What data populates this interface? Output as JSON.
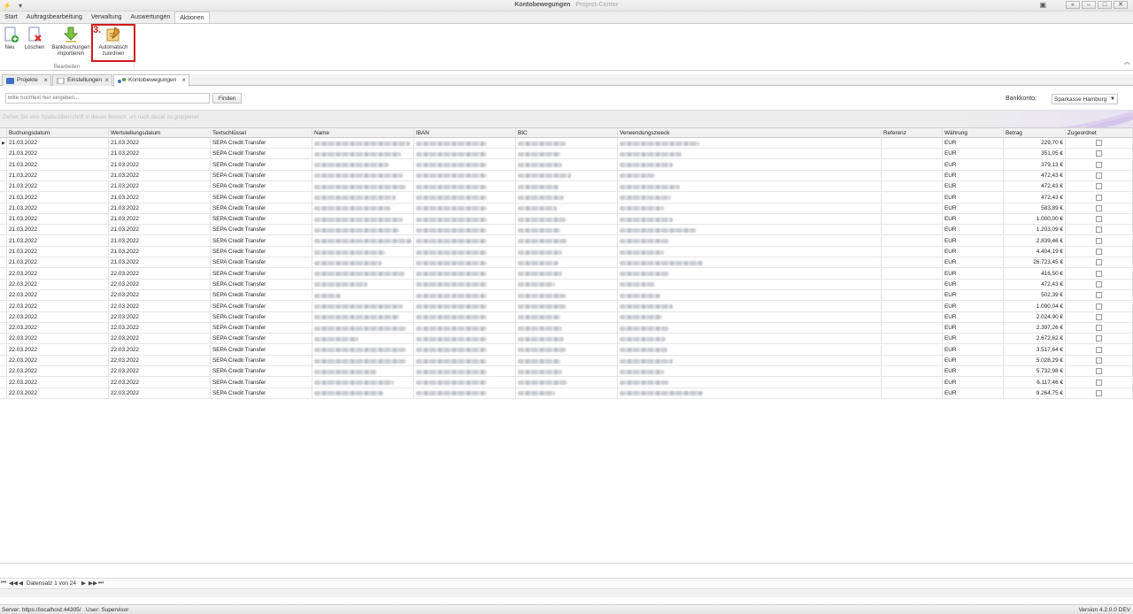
{
  "window": {
    "title": "Kontobewegungen",
    "subtitle": "Project-Center"
  },
  "ribbon_tabs": [
    "Start",
    "Auftragsbearbeitung",
    "Verwaltung",
    "Auswertungen",
    "Aktionen"
  ],
  "active_ribbon_tab": "Aktionen",
  "ribbon": {
    "group_label": "Bearbeiten",
    "buttons": {
      "neu": "Neu",
      "loeschen": "Löschen",
      "import_line1": "Bankbuchungen",
      "import_line2": "importieren",
      "auto_line1": "Automatisch",
      "auto_line2": "zuordnen"
    },
    "step_marker": "3.",
    "highlight_color": "#d11a1a"
  },
  "doc_tabs": [
    "Projekte",
    "Einstellungen",
    "Kontobewegungen"
  ],
  "active_doc_tab": "Kontobewegungen",
  "search": {
    "placeholder": "Bitte Suchtext hier eingeben...",
    "find_label": "Finden"
  },
  "bank": {
    "label": "Bankkonto:",
    "selected": "Sparkasse Hamburg"
  },
  "group_hint": "Ziehen Sie eine Spaltenüberschrift in diesen Bereich, um nach dieser zu gruppieren",
  "columns": [
    "Buchungsdatum",
    "Wertstellungsdatum",
    "Textschlüssel",
    "Name",
    "IBAN",
    "BIC",
    "Verwendungszweck",
    "Referenz",
    "Währung",
    "Betrag",
    "Zugeordnet"
  ],
  "rows": [
    {
      "buchung": "21.03.2022",
      "wert": "21.03.2022",
      "text": "SEPA Credit Transfer",
      "waehrung": "EUR",
      "betrag": "229,70 €"
    },
    {
      "buchung": "21.03.2022",
      "wert": "21.03.2022",
      "text": "SEPA Credit Transfer",
      "waehrung": "EUR",
      "betrag": "351,05 €"
    },
    {
      "buchung": "21.03.2022",
      "wert": "21.03.2022",
      "text": "SEPA Credit Transfer",
      "waehrung": "EUR",
      "betrag": "379,13 €"
    },
    {
      "buchung": "21.03.2022",
      "wert": "21.03.2022",
      "text": "SEPA Credit Transfer",
      "waehrung": "EUR",
      "betrag": "472,43 €"
    },
    {
      "buchung": "21.03.2022",
      "wert": "21.03.2022",
      "text": "SEPA Credit Transfer",
      "waehrung": "EUR",
      "betrag": "472,43 €"
    },
    {
      "buchung": "21.03.2022",
      "wert": "21.03.2022",
      "text": "SEPA Credit Transfer",
      "waehrung": "EUR",
      "betrag": "472,43 €"
    },
    {
      "buchung": "21.03.2022",
      "wert": "21.03.2022",
      "text": "SEPA Credit Transfer",
      "waehrung": "EUR",
      "betrag": "583,89 €"
    },
    {
      "buchung": "21.03.2022",
      "wert": "21.03.2022",
      "text": "SEPA Credit Transfer",
      "waehrung": "EUR",
      "betrag": "1.000,00 €"
    },
    {
      "buchung": "21.03.2022",
      "wert": "21.03.2022",
      "text": "SEPA Credit Transfer",
      "waehrung": "EUR",
      "betrag": "1.203,09 €"
    },
    {
      "buchung": "21.03.2022",
      "wert": "21.03.2022",
      "text": "SEPA Credit Transfer",
      "waehrung": "EUR",
      "betrag": "2.839,46 €"
    },
    {
      "buchung": "21.03.2022",
      "wert": "21.03.2022",
      "text": "SEPA Credit Transfer",
      "waehrung": "EUR",
      "betrag": "4.404,19 €"
    },
    {
      "buchung": "21.03.2022",
      "wert": "21.03.2022",
      "text": "SEPA Credit Transfer",
      "waehrung": "EUR",
      "betrag": "26.723,45 €"
    },
    {
      "buchung": "22.03.2022",
      "wert": "22.03.2022",
      "text": "SEPA Credit Transfer",
      "waehrung": "EUR",
      "betrag": "416,50 €"
    },
    {
      "buchung": "22.03.2022",
      "wert": "22.03.2022",
      "text": "SEPA Credit Transfer",
      "waehrung": "EUR",
      "betrag": "472,43 €"
    },
    {
      "buchung": "22.03.2022",
      "wert": "22.03.2022",
      "text": "SEPA Credit Transfer",
      "waehrung": "EUR",
      "betrag": "502,39 €"
    },
    {
      "buchung": "22.03.2022",
      "wert": "22.03.2022",
      "text": "SEPA Credit Transfer",
      "waehrung": "EUR",
      "betrag": "1.090,04 €"
    },
    {
      "buchung": "22.03.2022",
      "wert": "22.03.2022",
      "text": "SEPA Credit Transfer",
      "waehrung": "EUR",
      "betrag": "2.024,90 €"
    },
    {
      "buchung": "22.03.2022",
      "wert": "22.03.2022",
      "text": "SEPA Credit Transfer",
      "waehrung": "EUR",
      "betrag": "2.397,26 €"
    },
    {
      "buchung": "22.03.2022",
      "wert": "22.03.2022",
      "text": "SEPA Credit Transfer",
      "waehrung": "EUR",
      "betrag": "2.672,62 €"
    },
    {
      "buchung": "22.03.2022",
      "wert": "22.03.2022",
      "text": "SEPA Credit Transfer",
      "waehrung": "EUR",
      "betrag": "3.517,64 €"
    },
    {
      "buchung": "22.03.2022",
      "wert": "22.03.2022",
      "text": "SEPA Credit Transfer",
      "waehrung": "EUR",
      "betrag": "5.028,29 €"
    },
    {
      "buchung": "22.03.2022",
      "wert": "22.03.2022",
      "text": "SEPA Credit Transfer",
      "waehrung": "EUR",
      "betrag": "5.732,98 €"
    },
    {
      "buchung": "22.03.2022",
      "wert": "22.03.2022",
      "text": "SEPA Credit Transfer",
      "waehrung": "EUR",
      "betrag": "6.117,46 €"
    },
    {
      "buchung": "22.03.2022",
      "wert": "22.03.2022",
      "text": "SEPA Credit Transfer",
      "waehrung": "EUR",
      "betrag": "9.264,75 €"
    }
  ],
  "navigator": {
    "record_text": "Datensatz 1 von 24"
  },
  "status": {
    "server": "Server: https://localhost:44305/",
    "user": "User: Supervisor",
    "version": "Version 4.2.0.0 DEV"
  }
}
